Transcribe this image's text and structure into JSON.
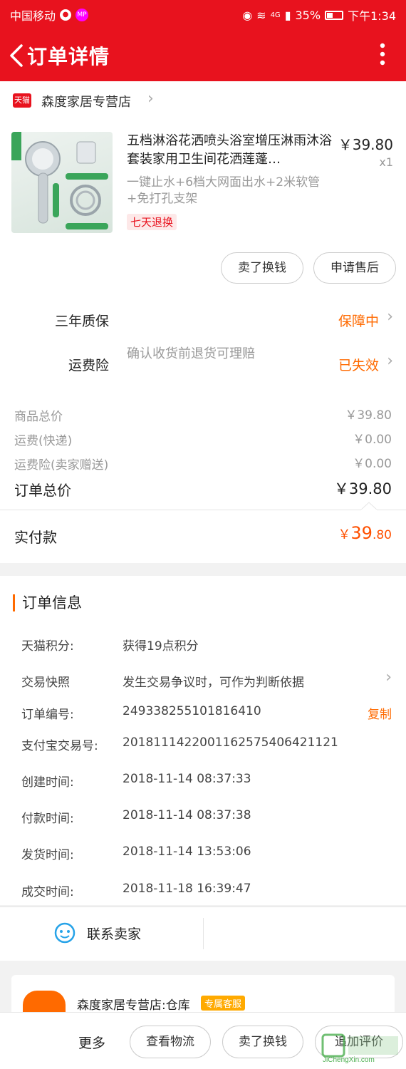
{
  "statusbar": {
    "carrier": "中国移动",
    "mp_badge": "MP",
    "network": "4G",
    "battery": "35%",
    "time": "下午1:34"
  },
  "nav": {
    "title": "订单详情"
  },
  "store": {
    "badge": "天猫",
    "name": "森度家居专营店"
  },
  "product": {
    "image_label_1": "五档止水 电镀花洒",
    "image_label_2": "太空铝免打孔支架",
    "image_label_3": "2米防爆花洒软管",
    "title": "五档淋浴花洒喷头浴室增压淋雨沐浴套装家用卫生间花洒莲蓬…",
    "price": "￥39.80",
    "qty": "x1",
    "sku": "一键止水+6档大网面出水+2米软管+免打孔支架",
    "tag": "七天退换",
    "btn_resell": "卖了换钱",
    "btn_aftersale": "申请售后"
  },
  "guarantee": {
    "warranty_label": "三年质保",
    "warranty_status": "保障中",
    "insurance_label": "运费险",
    "insurance_desc": "确认收货前退货可理赔",
    "insurance_status": "已失效"
  },
  "prices": {
    "items": [
      {
        "label": "商品总价",
        "value": "￥39.80"
      },
      {
        "label": "运费(快递)",
        "value": "￥0.00"
      },
      {
        "label": "运费险(卖家赠送)",
        "value": "￥0.00"
      }
    ],
    "total_label": "订单总价",
    "total_value": "￥39.80",
    "paid_label": "实付款",
    "paid_yen": "￥",
    "paid_int": "39",
    "paid_dec": ".80"
  },
  "order_info": {
    "heading": "订单信息",
    "rows": [
      {
        "key": "天猫积分:",
        "value": "获得19点积分"
      },
      {
        "key": "交易快照",
        "value": "发生交易争议时，可作为判断依据"
      },
      {
        "key": "订单编号:",
        "value": "249338255101816410"
      },
      {
        "key": "支付宝交易号:",
        "value": "2018111422001162575406421121"
      },
      {
        "key": "创建时间:",
        "value": "2018-11-14 08:37:33"
      },
      {
        "key": "付款时间:",
        "value": "2018-11-14 08:37:38"
      },
      {
        "key": "发货时间:",
        "value": "2018-11-14 13:53:06"
      },
      {
        "key": "成交时间:",
        "value": "2018-11-18 16:39:47"
      }
    ],
    "copy_label": "复制"
  },
  "contact": {
    "label": "联系卖家"
  },
  "shop_card": {
    "name": "森度家居专营店:仓库",
    "badge": "专属客服"
  },
  "bottombar": {
    "more": "更多",
    "logistics": "查看物流",
    "resell": "卖了换钱",
    "review": "追加评价"
  },
  "watermark": {
    "text": "JiChengXin.com"
  },
  "colors": {
    "brand_red": "#e8121e",
    "accent_orange": "#ff6a00"
  }
}
